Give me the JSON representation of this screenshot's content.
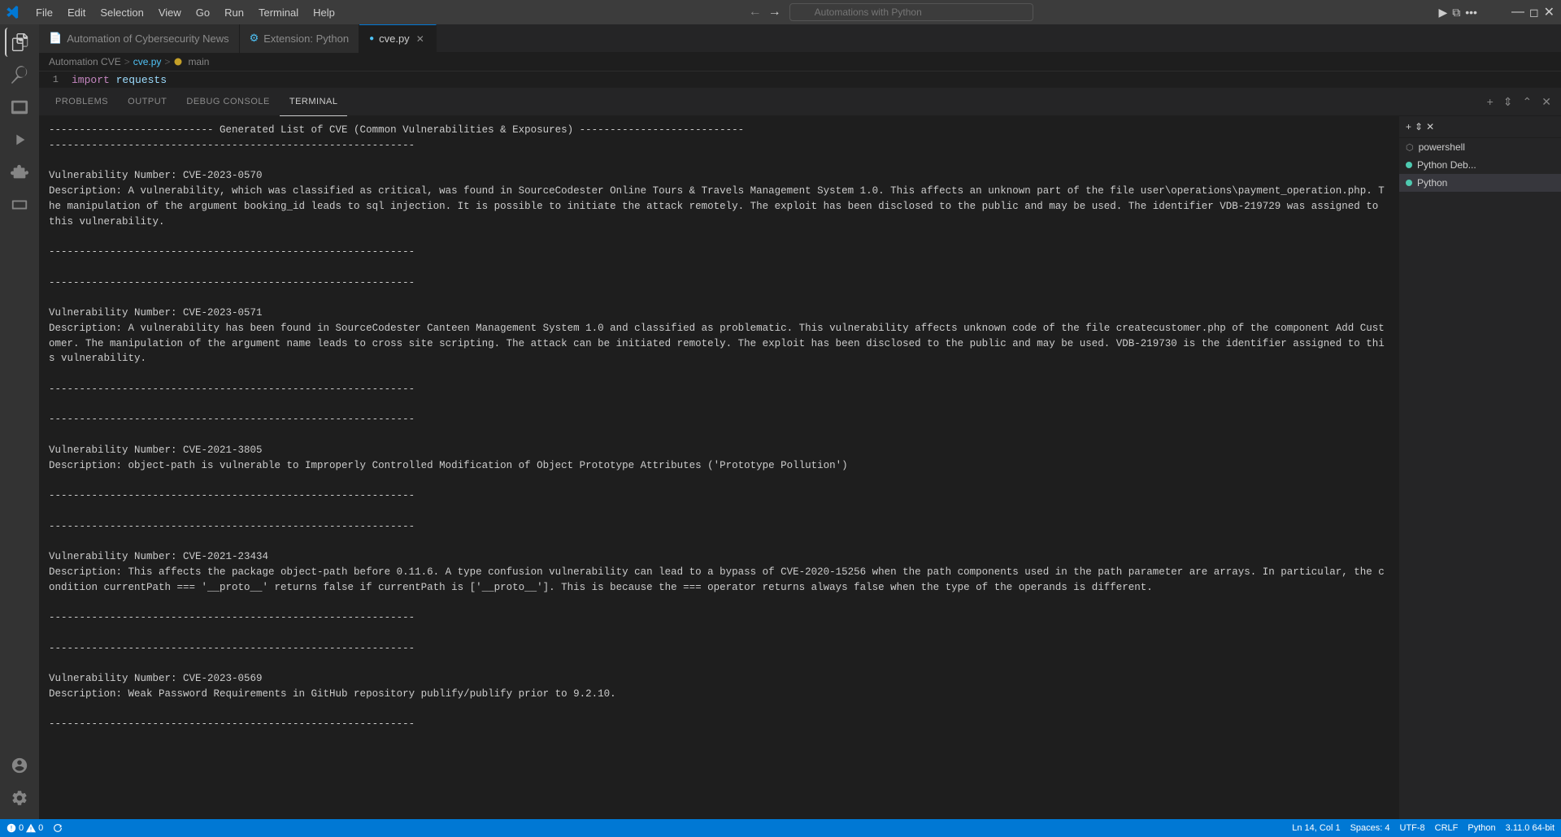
{
  "titlebar": {
    "menus": [
      "File",
      "Edit",
      "Selection",
      "View",
      "Go",
      "Run",
      "Terminal",
      "Help"
    ],
    "search_placeholder": "Automations with Python",
    "window_controls": [
      "minimize",
      "maximize",
      "close"
    ]
  },
  "tabs": [
    {
      "label": "Automation of Cybersecurity News",
      "icon": "file",
      "active": false,
      "closeable": false
    },
    {
      "label": "Extension: Python",
      "icon": "extension",
      "active": false,
      "closeable": false
    },
    {
      "label": "cve.py",
      "icon": "python",
      "active": true,
      "closeable": true
    }
  ],
  "breadcrumb": {
    "parts": [
      "Automation CVE",
      "cve.py",
      "main"
    ]
  },
  "code_line": {
    "number": "1",
    "content": "import requests"
  },
  "panel": {
    "tabs": [
      "PROBLEMS",
      "OUTPUT",
      "DEBUG CONSOLE",
      "TERMINAL"
    ],
    "active_tab": "TERMINAL"
  },
  "terminal": {
    "content": "--------------------------- Generated List of CVE (Common Vulnerabilities & Exposures) ---------------------------\n------------------------------------------------------------\n\nVulnerability Number: CVE-2023-0570\nDescription: A vulnerability, which was classified as critical, was found in SourceCodester Online Tours & Travels Management System 1.0. This affects an unknown part of the file user\\operations\\payment_operation.php. The manipulation of the argument booking_id leads to sql injection. It is possible to initiate the attack remotely. The exploit has been disclosed to the public and may be used. The identifier VDB-219729 was assigned to this vulnerability.\n\n------------------------------------------------------------\n\n------------------------------------------------------------\n\nVulnerability Number: CVE-2023-0571\nDescription: A vulnerability has been found in SourceCodester Canteen Management System 1.0 and classified as problematic. This vulnerability affects unknown code of the file createcustomer.php of the component Add Customer. The manipulation of the argument name leads to cross site scripting. The attack can be initiated remotely. The exploit has been disclosed to the public and may be used. VDB-219730 is the identifier assigned to this vulnerability.\n\n------------------------------------------------------------\n\n------------------------------------------------------------\n\nVulnerability Number: CVE-2021-3805\nDescription: object-path is vulnerable to Improperly Controlled Modification of Object Prototype Attributes ('Prototype Pollution')\n\n------------------------------------------------------------\n\n------------------------------------------------------------\n\nVulnerability Number: CVE-2021-23434\nDescription: This affects the package object-path before 0.11.6. A type confusion vulnerability can lead to a bypass of CVE-2020-15256 when the path components used in the path parameter are arrays. In particular, the condition currentPath === '__proto__' returns false if currentPath is ['__proto__']. This is because the === operator returns always false when the type of the operands is different.\n\n------------------------------------------------------------\n\n------------------------------------------------------------\n\nVulnerability Number: CVE-2023-0569\nDescription: Weak Password Requirements in GitHub repository publify/publify prior to 9.2.10.\n\n------------------------------------------------------------"
  },
  "right_panel": {
    "terminals": [
      {
        "label": "powershell",
        "active": false
      },
      {
        "label": "Python Deb...",
        "active": false
      },
      {
        "label": "Python",
        "active": true
      }
    ]
  },
  "status_bar": {
    "errors": "0",
    "warnings": "0",
    "position": "Ln 14, Col 1",
    "spaces": "Spaces: 4",
    "encoding": "UTF-8",
    "line_ending": "CRLF",
    "language": "Python",
    "version": "3.11.0 64-bit"
  }
}
